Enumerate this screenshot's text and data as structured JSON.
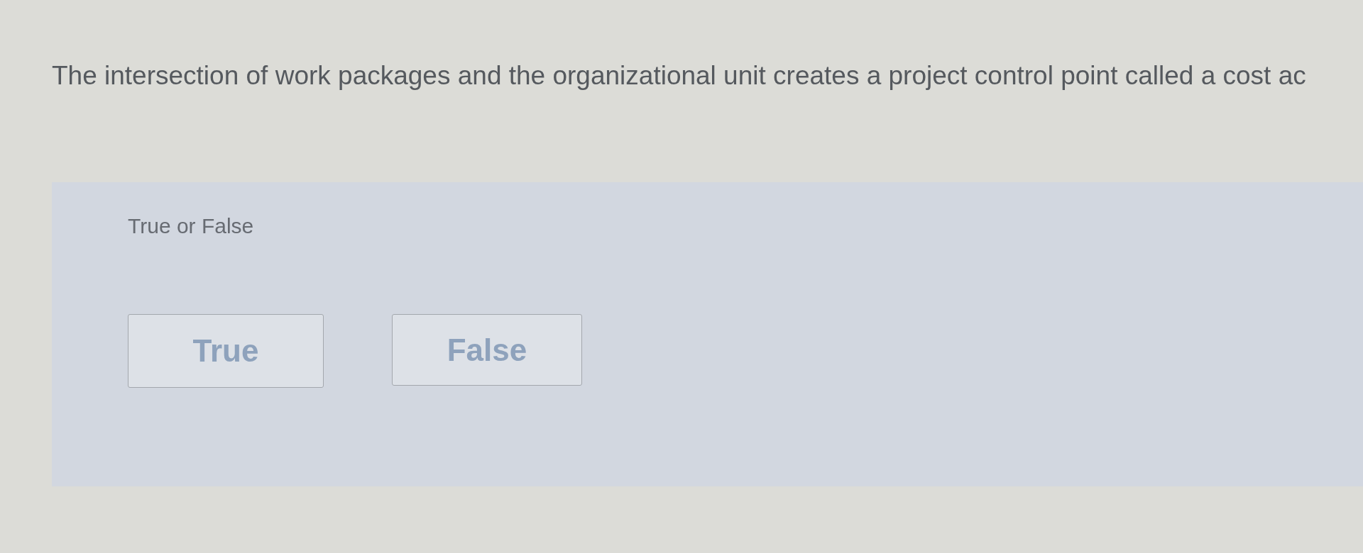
{
  "question": {
    "text": "The intersection of work packages and the organizational unit creates a project control point called a cost ac"
  },
  "prompt": {
    "label": "True or False"
  },
  "options": [
    {
      "label": "True"
    },
    {
      "label": "False"
    }
  ]
}
